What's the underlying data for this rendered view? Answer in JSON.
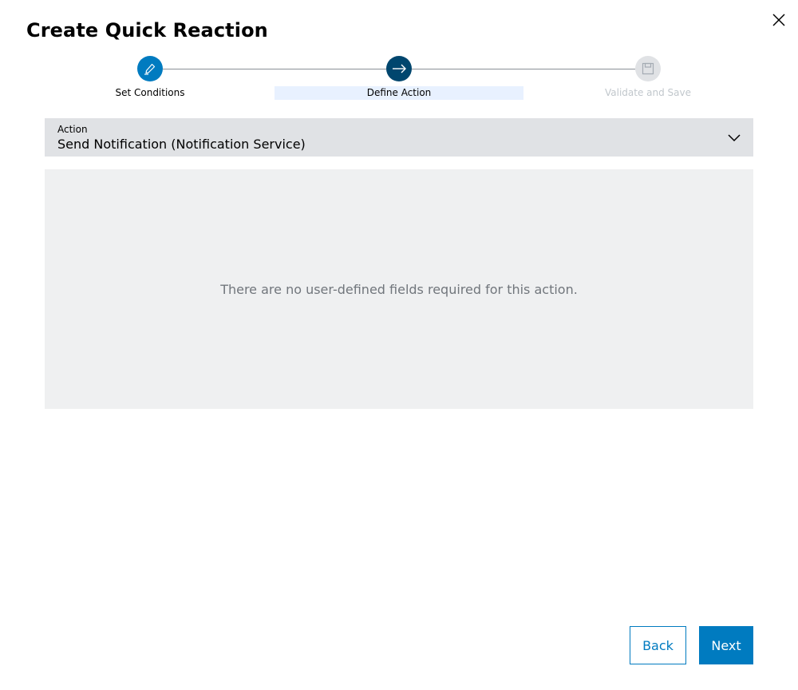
{
  "dialog": {
    "title": "Create Quick Reaction",
    "close_icon": "close-icon"
  },
  "stepper": {
    "steps": [
      {
        "label": "Set Conditions",
        "state": "completed",
        "icon": "pencil-icon",
        "color": "#007bc0"
      },
      {
        "label": "Define Action",
        "state": "active",
        "icon": "arrow-right-icon",
        "color": "#00466e"
      },
      {
        "label": "Validate and Save",
        "state": "disabled",
        "icon": "save-icon",
        "color": "#e0e2e5"
      }
    ]
  },
  "action": {
    "label": "Action",
    "value": "Send Notification (Notification Service)",
    "icon": "chevron-down-icon"
  },
  "info": {
    "message": "There are no user-defined fields required for this action."
  },
  "footer": {
    "back_label": "Back",
    "next_label": "Next",
    "accent_color": "#007bc0"
  }
}
